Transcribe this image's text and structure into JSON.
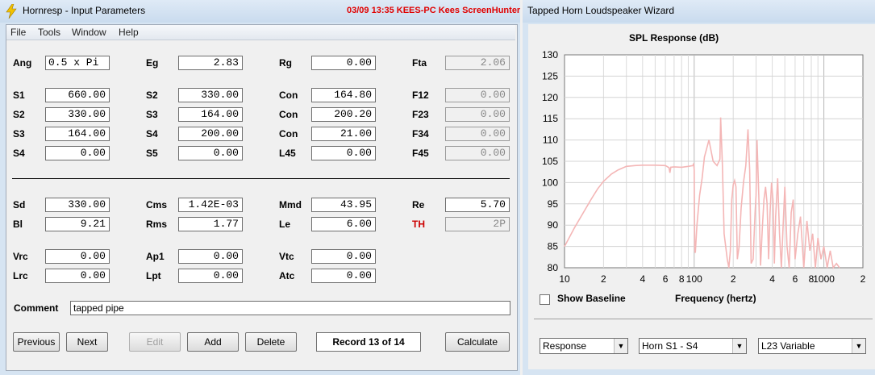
{
  "window_left": {
    "title": "Hornresp - Input Parameters",
    "overlay_text": "03/09  13:35  KEES-PC  Kees  ScreenHunter",
    "menu": [
      "File",
      "Tools",
      "Window",
      "Help"
    ],
    "rows": [
      [
        {
          "label": "Ang",
          "value": "0.5 x Pi",
          "left": true
        },
        {
          "label": "Eg",
          "value": "2.83"
        },
        {
          "label": "Rg",
          "value": "0.00"
        },
        {
          "label": "Fta",
          "value": "2.06",
          "ro": true
        }
      ],
      [
        {
          "label": "S1",
          "value": "660.00"
        },
        {
          "label": "S2",
          "value": "330.00"
        },
        {
          "label": "Con",
          "value": "164.80"
        },
        {
          "label": "F12",
          "value": "0.00",
          "ro": true
        }
      ],
      [
        {
          "label": "S2",
          "value": "330.00"
        },
        {
          "label": "S3",
          "value": "164.00"
        },
        {
          "label": "Con",
          "value": "200.20"
        },
        {
          "label": "F23",
          "value": "0.00",
          "ro": true
        }
      ],
      [
        {
          "label": "S3",
          "value": "164.00"
        },
        {
          "label": "S4",
          "value": "200.00"
        },
        {
          "label": "Con",
          "value": "21.00"
        },
        {
          "label": "F34",
          "value": "0.00",
          "ro": true
        }
      ],
      [
        {
          "label": "S4",
          "value": "0.00"
        },
        {
          "label": "S5",
          "value": "0.00"
        },
        {
          "label": "L45",
          "value": "0.00"
        },
        {
          "label": "F45",
          "value": "0.00",
          "ro": true
        }
      ],
      [
        {
          "label": "Sd",
          "value": "330.00"
        },
        {
          "label": "Cms",
          "value": "1.42E-03"
        },
        {
          "label": "Mmd",
          "value": "43.95"
        },
        {
          "label": "Re",
          "value": "5.70"
        }
      ],
      [
        {
          "label": "Bl",
          "value": "9.21"
        },
        {
          "label": "Rms",
          "value": "1.77"
        },
        {
          "label": "Le",
          "value": "6.00"
        },
        {
          "label": "TH",
          "value": "2P",
          "ro": true,
          "red": true
        }
      ],
      [
        {
          "label": "Vrc",
          "value": "0.00"
        },
        {
          "label": "Ap1",
          "value": "0.00"
        },
        {
          "label": "Vtc",
          "value": "0.00"
        }
      ],
      [
        {
          "label": "Lrc",
          "value": "0.00"
        },
        {
          "label": "Lpt",
          "value": "0.00"
        },
        {
          "label": "Atc",
          "value": "0.00"
        }
      ]
    ],
    "comment_label": "Comment",
    "comment_value": "tapped pipe",
    "buttons": {
      "previous": "Previous",
      "next": "Next",
      "edit": "Edit",
      "add": "Add",
      "delete": "Delete",
      "calculate": "Calculate"
    },
    "record": "Record 13 of 14"
  },
  "window_right": {
    "title": "Tapped Horn Loudspeaker Wizard",
    "show_baseline": "Show Baseline",
    "selects": [
      "Response",
      "Horn S1 - S4",
      "L23 Variable"
    ]
  },
  "chart_data": {
    "type": "line",
    "title": "SPL Response (dB)",
    "xlabel": "Frequency (hertz)",
    "x_scale": "log",
    "xlim": [
      10,
      2000
    ],
    "ylim": [
      80,
      130
    ],
    "y_ticks": [
      80,
      85,
      90,
      95,
      100,
      105,
      110,
      115,
      120,
      125,
      130
    ],
    "x_tick_labels": [
      "10",
      "2",
      "4",
      "6",
      "8",
      "100",
      "2",
      "4",
      "6",
      "8",
      "1000",
      "2"
    ],
    "x_tick_values": [
      10,
      20,
      40,
      60,
      80,
      100,
      200,
      400,
      600,
      800,
      1000,
      2000
    ],
    "line_color": "#f4b6b6",
    "series": [
      {
        "x": [
          10,
          12,
          14,
          16,
          18,
          20,
          23,
          26,
          30,
          35,
          40,
          50,
          60,
          64,
          65,
          66,
          70,
          80,
          90,
          98,
          99,
          100,
          101,
          102,
          105,
          110,
          115,
          120,
          130,
          140,
          150,
          158,
          160,
          165,
          170,
          180,
          185,
          190,
          195,
          200,
          205,
          210,
          215,
          222,
          230,
          240,
          250,
          260,
          268,
          275,
          285,
          295,
          300,
          305,
          315,
          325,
          335,
          345,
          355,
          365,
          375,
          385,
          395,
          405,
          415,
          425,
          440,
          455,
          470,
          485,
          500,
          520,
          540,
          560,
          580,
          600,
          630,
          660,
          700,
          740,
          780,
          820,
          860,
          900,
          950,
          1000,
          1060,
          1120,
          1180,
          1250,
          1320
        ],
        "y": [
          85.0,
          89.5,
          93.0,
          96.0,
          98.5,
          100.3,
          102.0,
          103.0,
          103.8,
          104.0,
          104.1,
          104.1,
          104.0,
          103.5,
          102.3,
          103.6,
          103.7,
          103.6,
          103.8,
          104.0,
          104.5,
          103.0,
          84.0,
          83.5,
          90.0,
          97.0,
          101.0,
          106.0,
          110.0,
          105.0,
          104.0,
          105.5,
          115.3,
          104.0,
          88.0,
          82.0,
          80.0,
          84.0,
          96.0,
          99.5,
          100.5,
          99.0,
          82.0,
          85.0,
          94.0,
          100.0,
          104.0,
          112.5,
          103.0,
          81.0,
          82.0,
          93.0,
          97.0,
          110.0,
          97.0,
          80.5,
          89.0,
          96.0,
          99.0,
          95.0,
          82.0,
          93.0,
          100.0,
          96.0,
          81.0,
          92.0,
          101.0,
          88.0,
          80.0,
          90.0,
          99.0,
          85.0,
          80.0,
          93.0,
          96.0,
          82.0,
          88.0,
          92.0,
          80.0,
          91.0,
          84.0,
          88.0,
          80.0,
          87.0,
          82.0,
          85.0,
          80.0,
          84.0,
          80.0,
          81.0,
          80.0
        ]
      }
    ]
  }
}
